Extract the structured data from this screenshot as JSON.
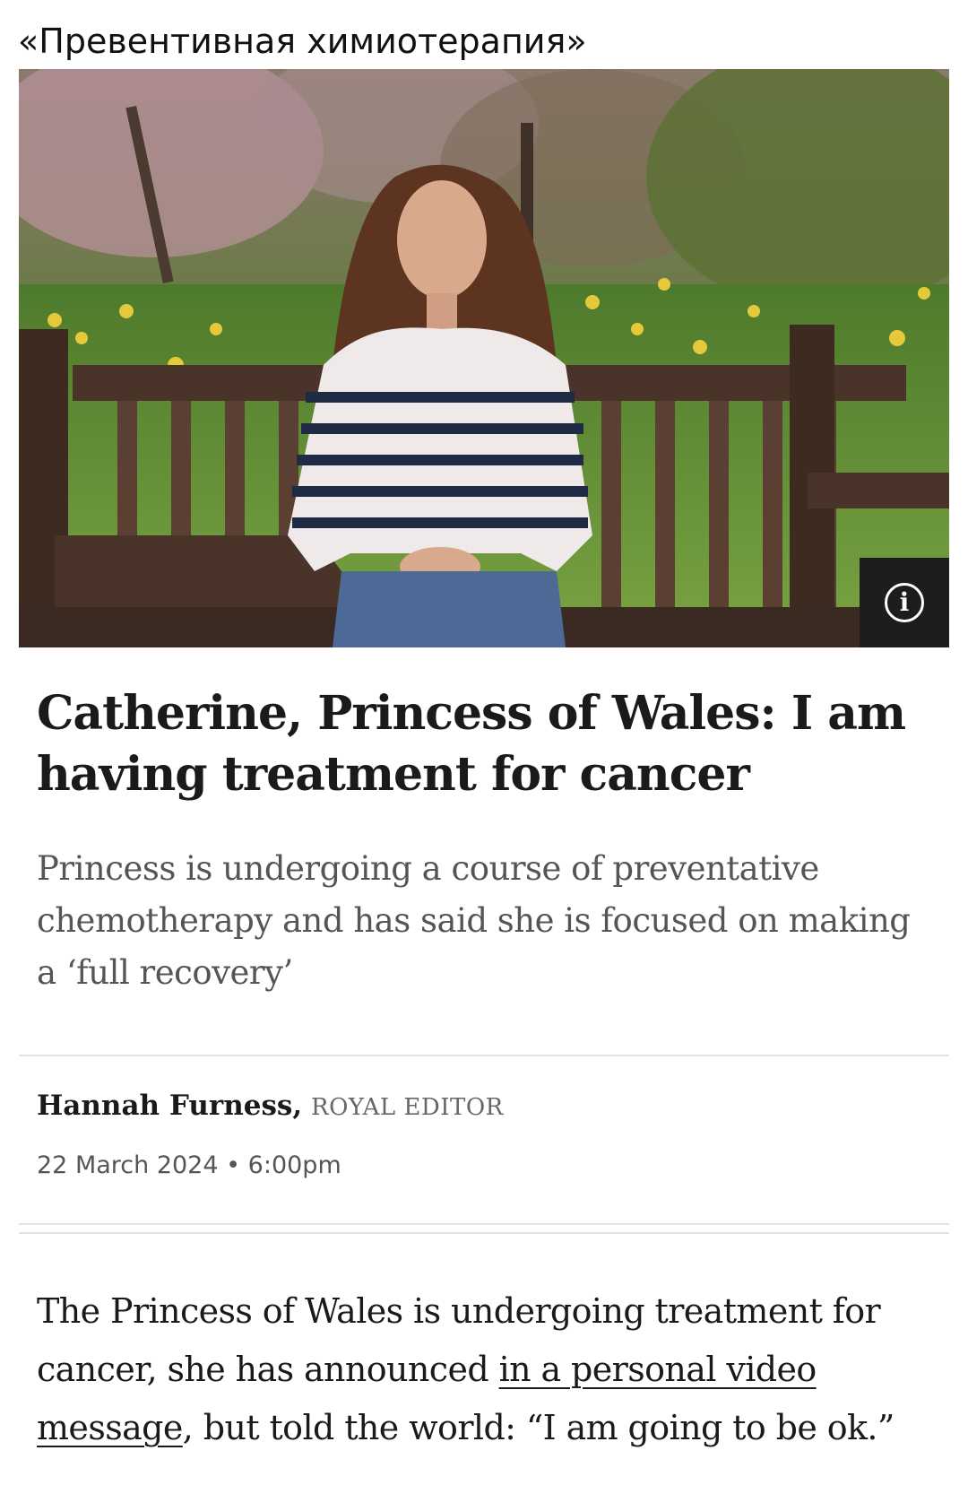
{
  "top_caption": "«Превентивная химиотерапия»",
  "hero": {
    "image_alt": "Woman in striped sweater seated on wooden bench in a garden",
    "info_icon": "info-circle-icon",
    "info_glyph": "i"
  },
  "article": {
    "headline": "Catherine, Princess of Wales: I am having treatment for cancer",
    "standfirst": "Princess is undergoing a course of preventative chemotherapy and has said she is focused on making a ‘full recovery’",
    "author": "Hannah Furness,",
    "author_role": "Royal Editor",
    "date": "22 March 2024",
    "date_separator": "•",
    "time": "6:00pm",
    "body_intro": "The Princess of Wales is undergoing treatment for cancer, she has announced ",
    "body_link": "in a personal video message",
    "body_outro": ", but told the world: “I am going to be ok.”"
  },
  "colors": {
    "headline": "#1a1a1a",
    "standfirst": "#555555",
    "rule": "#e3e3e3",
    "info_bg": "#1d1d1d"
  }
}
